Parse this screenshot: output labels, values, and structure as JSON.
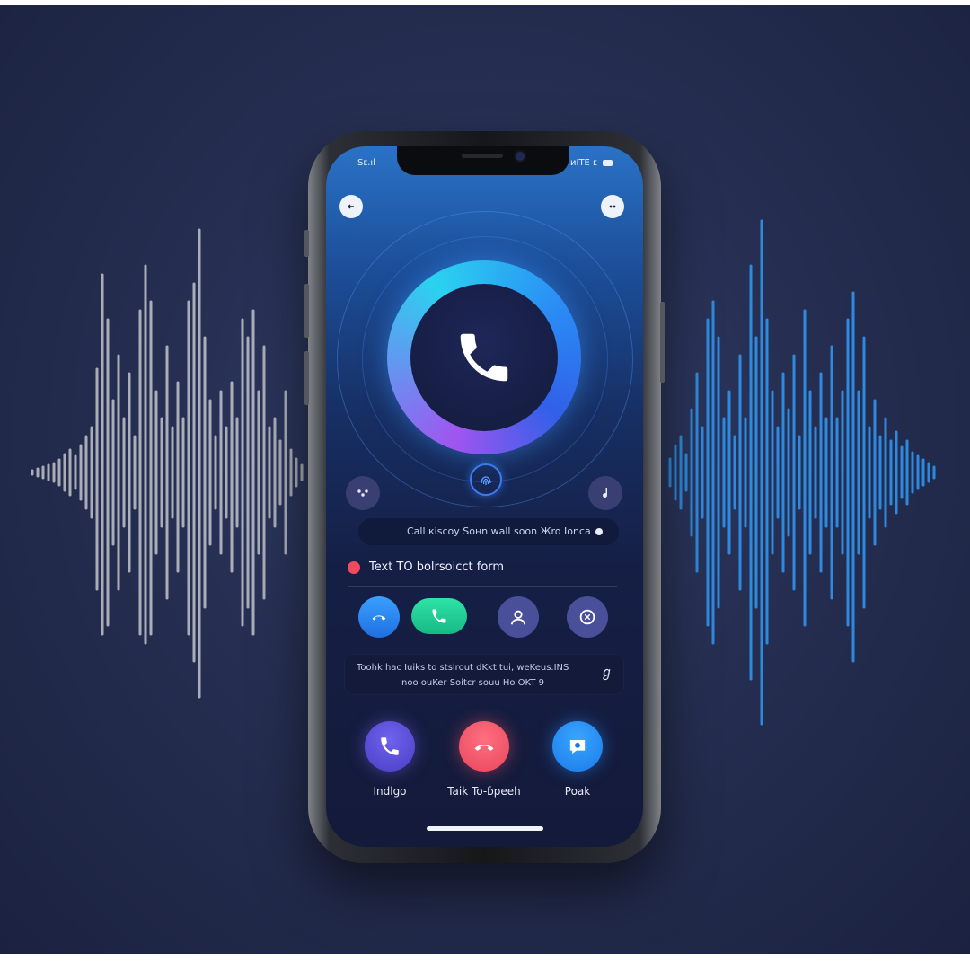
{
  "status_bar": {
    "left": "Sᴇ.ıl",
    "right": "ᴎITE ᴇ"
  },
  "header": {
    "left_button_icon": "back-icon",
    "right_button_icon": "more-icon"
  },
  "main_call_icon": "phone-icon",
  "fingerprint_icon": "fingerprint-icon",
  "side_left_icon": "dots-icon",
  "side_right_icon": "music-note-icon",
  "info_bar": {
    "text": "Call кiscoy Soнn wаll soon Жro Ionca"
  },
  "section": {
    "label": "Text TO bolrsoicct form"
  },
  "quick_actions": [
    {
      "icon": "call-icon",
      "color": "#2f87ef"
    },
    {
      "icon": "chat-call-icon",
      "color": "#23c993"
    },
    {
      "icon": "contact-icon",
      "color": "#4a4f9a"
    },
    {
      "icon": "voice-icon",
      "color": "#4a4f9a"
    }
  ],
  "message": {
    "line1": "Toohk hac Iuiks to stslrout dKkt tui, weKeus.INS",
    "line2": "noo ouKer Soitcr souu Ho OKT 9",
    "icon_text": "ℊ"
  },
  "actions": [
    {
      "label": "Indlgo",
      "icon": "phone-icon",
      "color": "#5a4fd6"
    },
    {
      "label": "Taik To-ɓpeeh",
      "icon": "hang-up-icon",
      "color": "#f0566a"
    },
    {
      "label": "Poak",
      "icon": "voice-bubble-icon",
      "color": "#1e8cf0"
    }
  ]
}
